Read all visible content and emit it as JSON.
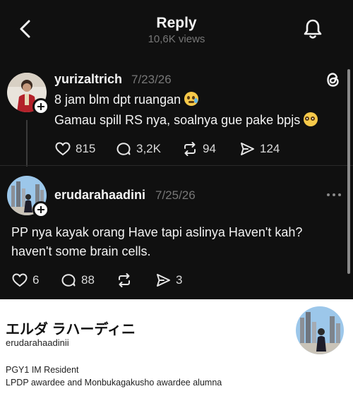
{
  "header": {
    "title": "Reply",
    "views": "10,6K views"
  },
  "posts": [
    {
      "username": "yurizaltrich",
      "date": "7/23/26",
      "lines": [
        "8 jam blm dpt ruangan",
        "Gamau spill RS nya, soalnya gue pake bpjs"
      ],
      "emojis": [
        "crying-face",
        "pleading-face"
      ],
      "likes": "815",
      "replies": "3,2K",
      "reposts": "94",
      "shares": "124"
    },
    {
      "username": "erudarahaadini",
      "date": "7/25/26",
      "lines": [
        "PP nya kayak orang Have tapi aslinya Haven't kah?",
        "haven't some brain cells."
      ],
      "likes": "6",
      "replies": "88",
      "reposts": "",
      "shares": "3"
    }
  ],
  "profile": {
    "display_name": "エルダ ラハーディニ",
    "handle": "erudarahaadinii",
    "bio": [
      "PGY1 IM Resident",
      "LPDP awardee and Monbukagakusho awardee alumna"
    ]
  },
  "colors": {
    "background_dark": "#101010",
    "text_primary": "#f3f3f3",
    "text_secondary": "#777777",
    "profile_background": "#ffffff"
  },
  "icons": [
    "back-chevron-icon",
    "bell-icon",
    "threads-logo-icon",
    "heart-icon",
    "comment-icon",
    "repost-icon",
    "share-icon",
    "more-icon",
    "plus-icon"
  ]
}
